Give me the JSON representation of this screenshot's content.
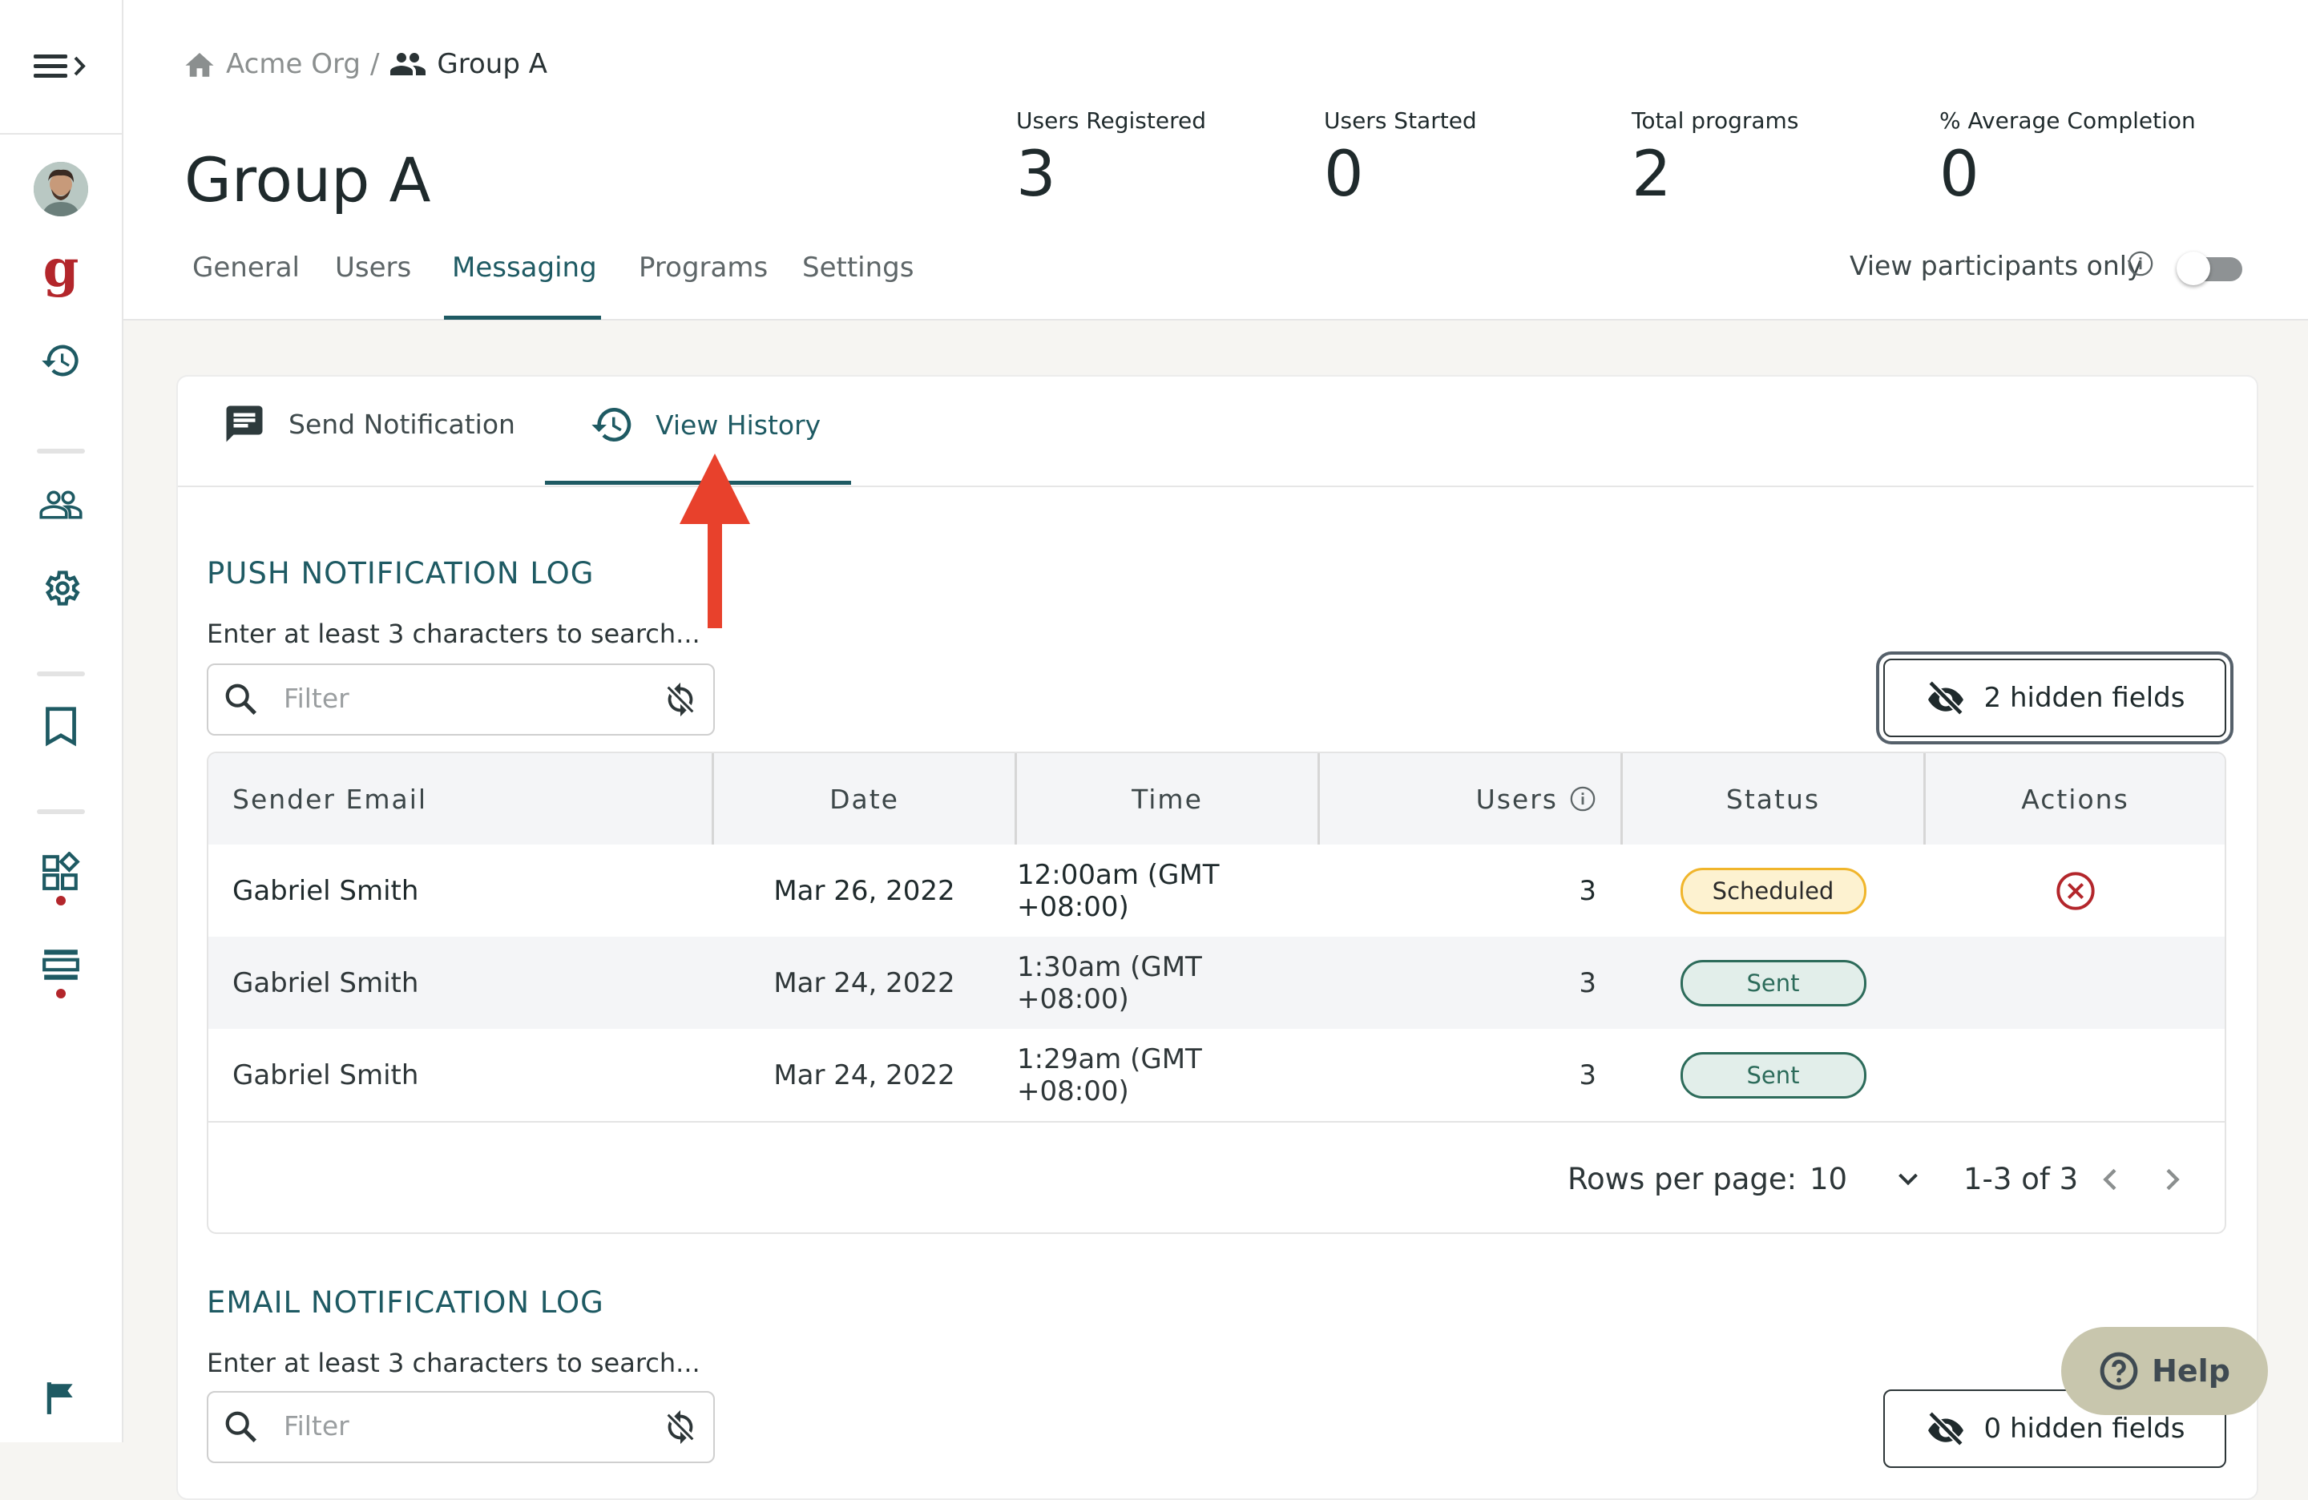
{
  "sidebar": {
    "toggle_icon": "menu-expand-icon",
    "items": [
      {
        "name": "avatar",
        "icon": "user-avatar"
      },
      {
        "name": "brand-logo",
        "icon": "g-logo",
        "text": "g"
      },
      {
        "name": "history",
        "icon": "history-icon"
      },
      {
        "name": "groups",
        "icon": "people-icon"
      },
      {
        "name": "settings",
        "icon": "gear-icon"
      },
      {
        "name": "bookmarks",
        "icon": "bookmark-icon"
      },
      {
        "name": "apps",
        "icon": "apps-icon"
      },
      {
        "name": "list",
        "icon": "list-icon"
      },
      {
        "name": "flag",
        "icon": "flag-icon"
      }
    ]
  },
  "breadcrumb": {
    "org": "Acme Org",
    "separator": "/",
    "group": "Group A"
  },
  "page_title": "Group A",
  "stats": [
    {
      "label": "Users Registered",
      "value": "3"
    },
    {
      "label": "Users Started",
      "value": "0"
    },
    {
      "label": "Total programs",
      "value": "2"
    },
    {
      "label": "% Average Completion",
      "value": "0"
    }
  ],
  "tabs": [
    {
      "label": "General",
      "active": false
    },
    {
      "label": "Users",
      "active": false
    },
    {
      "label": "Messaging",
      "active": true
    },
    {
      "label": "Programs",
      "active": false
    },
    {
      "label": "Settings",
      "active": false
    }
  ],
  "participants_toggle": {
    "label": "View participants only",
    "on": false
  },
  "sub_tabs": [
    {
      "label": "Send Notification",
      "icon": "message-icon",
      "active": false
    },
    {
      "label": "View History",
      "icon": "history-icon",
      "active": true
    }
  ],
  "push_log": {
    "title": "PUSH NOTIFICATION LOG",
    "search_hint": "Enter at least 3 characters to search...",
    "filter_placeholder": "Filter",
    "hidden_fields_label": "2 hidden fields",
    "columns": [
      "Sender Email",
      "Date",
      "Time",
      "Users",
      "Status",
      "Actions"
    ],
    "rows": [
      {
        "sender": "Gabriel Smith",
        "date": "Mar 26, 2022",
        "time": "12:00am (GMT +08:00)",
        "users": "3",
        "status": "Scheduled",
        "action": "cancel"
      },
      {
        "sender": "Gabriel Smith",
        "date": "Mar 24, 2022",
        "time": "1:30am (GMT +08:00)",
        "users": "3",
        "status": "Sent",
        "action": ""
      },
      {
        "sender": "Gabriel Smith",
        "date": "Mar 24, 2022",
        "time": "1:29am (GMT +08:00)",
        "users": "3",
        "status": "Sent",
        "action": ""
      }
    ],
    "pagination": {
      "rows_per_page_label": "Rows per page:",
      "rows_per_page": "10",
      "range": "1-3 of 3"
    }
  },
  "email_log": {
    "title": "EMAIL NOTIFICATION LOG",
    "search_hint": "Enter at least 3 characters to search...",
    "filter_placeholder": "Filter",
    "hidden_fields_label": "0 hidden fields"
  },
  "help_button": {
    "label": "Help"
  },
  "colors": {
    "accent": "#1e5a63",
    "annotation_arrow": "#e8412c",
    "scheduled": "#f0b52b",
    "sent": "#2c6b5a",
    "danger": "#b3262b"
  }
}
